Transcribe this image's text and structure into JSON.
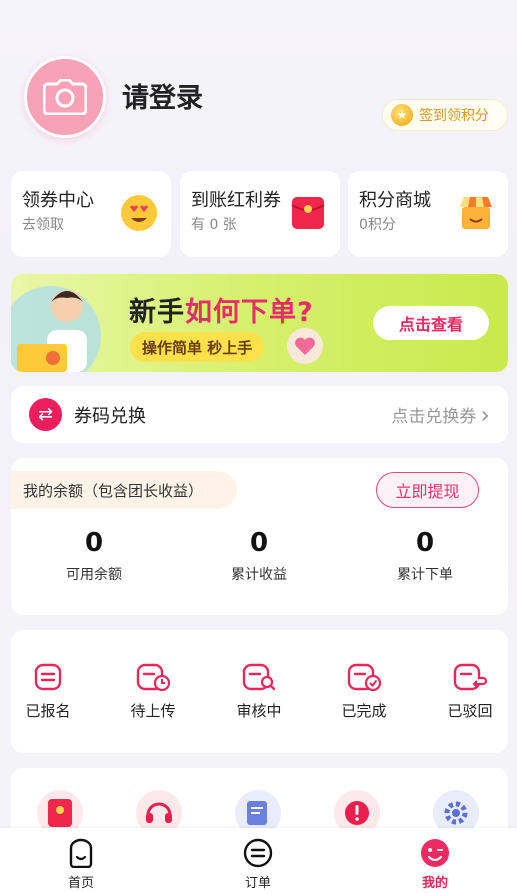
{
  "header": {
    "login_title": "请登录",
    "signin_label": "签到领积分",
    "avatar_icon": "camera-icon"
  },
  "cards": [
    {
      "title": "领券中心",
      "subtitle": "去领取",
      "icon": "heart-eyes-emoji-icon"
    },
    {
      "title": "到账红利券",
      "subtitle": "有 0 张",
      "icon": "red-envelope-icon"
    },
    {
      "title": "积分商城",
      "subtitle": "0积分",
      "icon": "shop-icon"
    }
  ],
  "banner": {
    "title_dark": "新手",
    "title_accent": "如何下单?",
    "subtitle": "操作简单 秒上手",
    "button": "点击查看"
  },
  "exchange": {
    "label": "券码兑换",
    "action": "点击兑换券",
    "chevron": "›"
  },
  "balance": {
    "tag": "我的余额（包含团长收益）",
    "withdraw_button": "立即提现",
    "stats": [
      {
        "value": "0",
        "label": "可用余额"
      },
      {
        "value": "0",
        "label": "累计收益"
      },
      {
        "value": "0",
        "label": "累计下单"
      }
    ]
  },
  "orders": [
    {
      "label": "已报名",
      "icon": "doc-icon"
    },
    {
      "label": "待上传",
      "icon": "doc-clock-icon"
    },
    {
      "label": "审核中",
      "icon": "doc-search-icon"
    },
    {
      "label": "已完成",
      "icon": "doc-check-icon"
    },
    {
      "label": "已驳回",
      "icon": "doc-return-icon"
    }
  ],
  "tools": [
    {
      "icon": "red-packet-icon"
    },
    {
      "icon": "headset-icon"
    },
    {
      "icon": "notepad-icon"
    },
    {
      "icon": "alert-icon"
    },
    {
      "icon": "settings-gear-icon"
    }
  ],
  "tabbar": {
    "items": [
      {
        "label": "首页",
        "icon": "home-face-icon",
        "active": false
      },
      {
        "label": "订单",
        "icon": "order-list-icon",
        "active": false
      },
      {
        "label": "我的",
        "icon": "profile-smile-icon",
        "active": true
      }
    ]
  },
  "colors": {
    "accent": "#e8285c",
    "banner_green": "#c7ea4c",
    "gold": "#d89a1c"
  }
}
